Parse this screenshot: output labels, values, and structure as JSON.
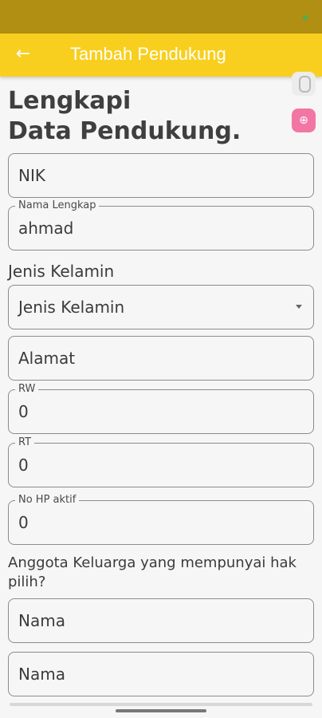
{
  "appbar": {
    "title": "Tambah Pendukung",
    "back_icon": "arrow-left-icon"
  },
  "heading": {
    "line1": "Lengkapi",
    "line2": "Data Pendukung."
  },
  "form": {
    "nik": {
      "placeholder": "NIK"
    },
    "nama_lengkap": {
      "label": "Nama Lengkap",
      "value": "ahmad"
    },
    "jenis_kelamin": {
      "section_label": "Jenis Kelamin",
      "selected": "Jenis Kelamin"
    },
    "alamat": {
      "placeholder": "Alamat"
    },
    "rw": {
      "label": "RW",
      "value": "0"
    },
    "rt": {
      "label": "RT",
      "value": "0"
    },
    "no_hp": {
      "label": "No HP aktif",
      "value": "0"
    },
    "anggota_question": "Anggota Keluarga yang mempunyai hak pilih?",
    "anggota_1": {
      "placeholder": "Nama"
    },
    "anggota_2": {
      "placeholder": "Nama"
    }
  },
  "side_tools": {
    "mouse_icon": "mouse-icon",
    "zoom_icon": "zoom-in-icon"
  },
  "colors": {
    "statusbar": "#b18f12",
    "appbar": "#f8cf1f",
    "zoom_button": "#f276a3"
  }
}
